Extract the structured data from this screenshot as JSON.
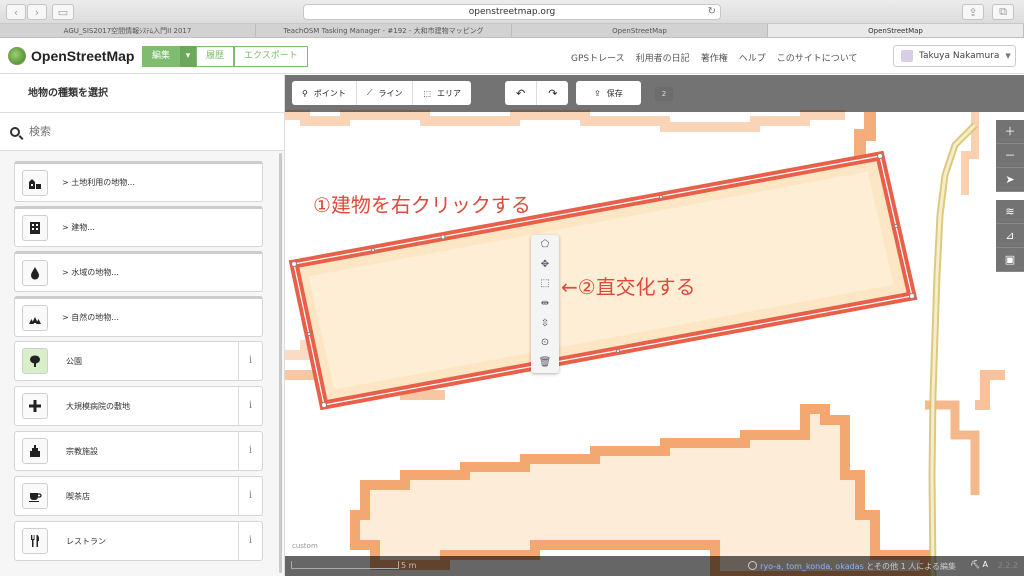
{
  "browser": {
    "url": "openstreetmap.org",
    "reload_icon": "reload-icon",
    "tabs": [
      {
        "label": "AGU_SIS2017空間情報ｼｽﾃﾑ入門II 2017",
        "active": false
      },
      {
        "label": "TeachOSM Tasking Manager - #192 - 大和市建物マッピング",
        "active": false
      },
      {
        "label": "OpenStreetMap",
        "active": false
      },
      {
        "label": "OpenStreetMap",
        "active": true
      }
    ]
  },
  "header": {
    "brand": "OpenStreetMap",
    "buttons": {
      "edit": "編集",
      "history": "履歴",
      "export": "エクスポート"
    },
    "nav": [
      "GPSトレース",
      "利用者の日記",
      "著作権",
      "ヘルプ",
      "このサイトについて"
    ],
    "user": "Takuya Nakamura",
    "accent": "#7ebc6f"
  },
  "sidebar": {
    "title": "地物の種類を選択",
    "search_placeholder": "検索",
    "categories": [
      {
        "label": "> 土地利用の地物...",
        "icon": "landuse-icon"
      },
      {
        "label": "> 建物...",
        "icon": "building-icon"
      },
      {
        "label": "> 水域の地物...",
        "icon": "water-icon"
      },
      {
        "label": "> 自然の地物...",
        "icon": "nature-icon"
      }
    ],
    "presets": [
      {
        "label": "公園",
        "icon": "tree-icon"
      },
      {
        "label": "大規模病院の敷地",
        "icon": "hospital-icon"
      },
      {
        "label": "宗教施設",
        "icon": "religious-icon"
      },
      {
        "label": "喫茶店",
        "icon": "cafe-icon"
      },
      {
        "label": "レストラン",
        "icon": "restaurant-icon"
      }
    ],
    "info_glyph": "i"
  },
  "toolbar": {
    "point": "ポイント",
    "line": "ライン",
    "area": "エリア",
    "save": "保存",
    "count": "2"
  },
  "map": {
    "custom_label": "custom",
    "scale_label": "5 m",
    "attribution_users": "ryo-a, tom_konda, okadas",
    "attribution_text": "とその他 1 人による編集",
    "language": "A",
    "version": "2.2.2",
    "annotation_1": "①建物を右クリックする",
    "annotation_2": "←②直交化する",
    "edit_menu": [
      "circularize-icon",
      "move-icon",
      "orthogonalize-icon",
      "reflect-long-icon",
      "reflect-short-icon",
      "disconnect-icon",
      "delete-icon"
    ],
    "colors": {
      "area_stroke": "#e8604a",
      "area_fill": "#fde6c4",
      "pixel_orange": "#f19a5a",
      "path_yellow": "#d8c372"
    }
  }
}
